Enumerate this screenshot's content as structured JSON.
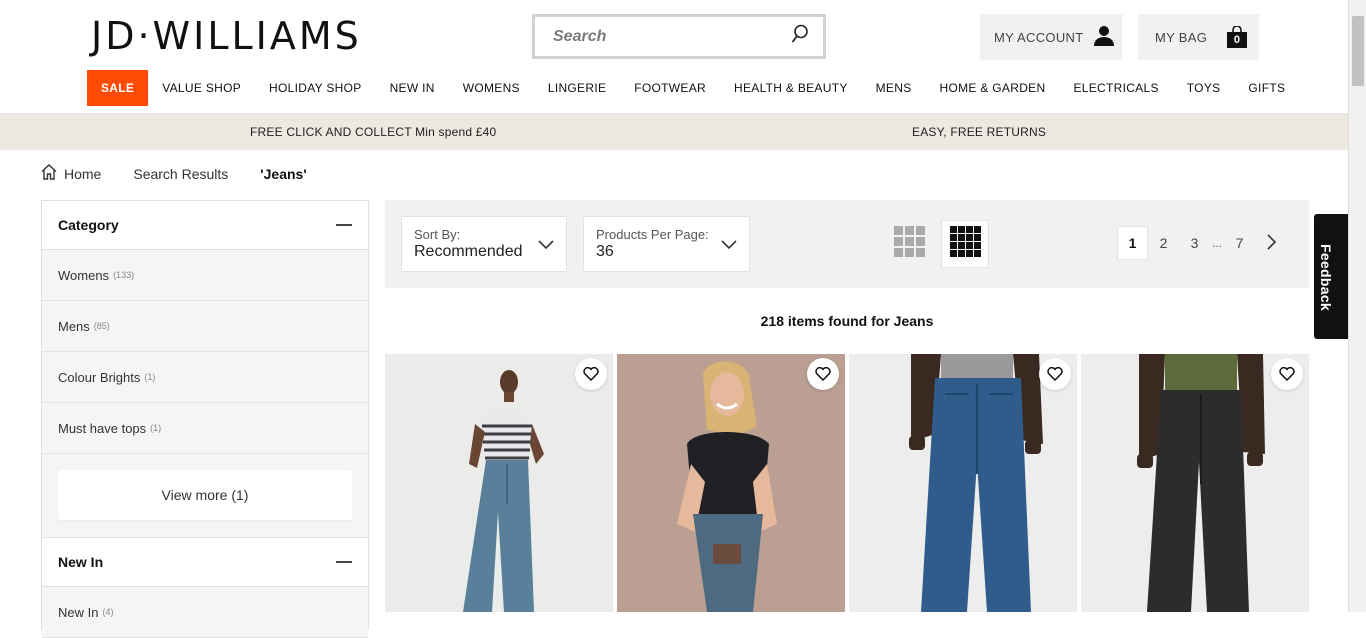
{
  "header": {
    "logo": "JD·WILLIAMS",
    "search_placeholder": "Search",
    "account_label": "MY ACCOUNT",
    "bag_label": "MY BAG",
    "bag_count": "0"
  },
  "nav": {
    "items": [
      "SALE",
      "VALUE SHOP",
      "HOLIDAY SHOP",
      "NEW IN",
      "WOMENS",
      "LINGERIE",
      "FOOTWEAR",
      "HEALTH & BEAUTY",
      "MENS",
      "HOME & GARDEN",
      "ELECTRICALS",
      "TOYS",
      "GIFTS"
    ]
  },
  "promo": {
    "left": "FREE CLICK AND COLLECT Min spend £40",
    "right": "EASY, FREE RETURNS"
  },
  "breadcrumb": {
    "home": "Home",
    "search": "Search Results",
    "current": "'Jeans'"
  },
  "filters": {
    "category": {
      "title": "Category",
      "items": [
        {
          "label": "Womens",
          "count": "(133)"
        },
        {
          "label": "Mens",
          "count": "(85)"
        },
        {
          "label": "Colour Brights",
          "count": "(1)"
        },
        {
          "label": "Must have tops",
          "count": "(1)"
        }
      ],
      "view_more": "View more (1)"
    },
    "new_in": {
      "title": "New In",
      "items": [
        {
          "label": "New In",
          "count": "(4)"
        }
      ]
    }
  },
  "toolbar": {
    "sort_label": "Sort By:",
    "sort_value": "Recommended",
    "per_page_label": "Products Per Page:",
    "per_page_value": "36",
    "pages": [
      "1",
      "2",
      "3"
    ],
    "ellipsis": "...",
    "last_page": "7"
  },
  "results": {
    "summary": "218 items found for Jeans"
  },
  "feedback": "Feedback",
  "colors": {
    "sale": "#fe4c06",
    "promo_bg": "#ede8e0",
    "toolbar_bg": "#f1f1f1"
  }
}
